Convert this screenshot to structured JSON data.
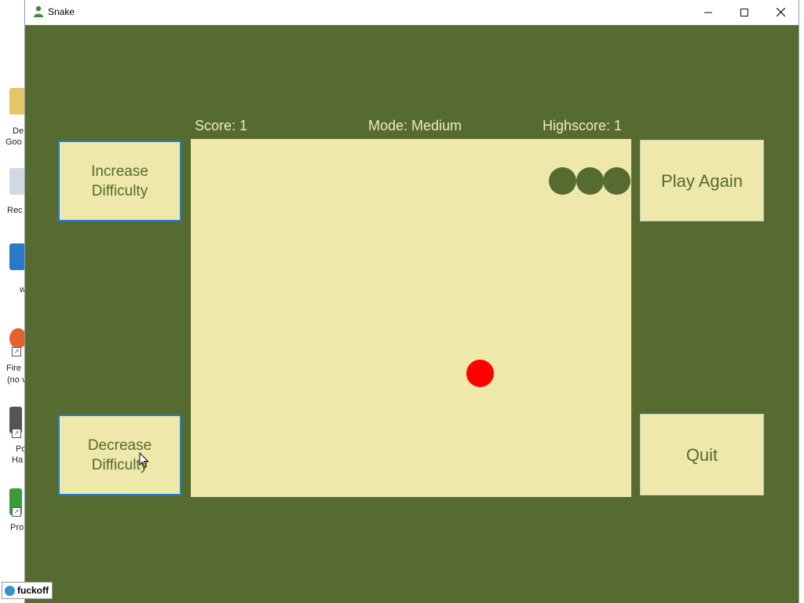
{
  "window": {
    "title": "Snake",
    "minimize_glyph": "—",
    "maximize_glyph": "☐",
    "close_glyph": "✕"
  },
  "desktop": {
    "labels": [
      "De",
      "Goo",
      "Rec",
      "w",
      "Fire",
      "(no v",
      "Po",
      "Ha",
      "Pro"
    ]
  },
  "status": {
    "score": "Score: 1",
    "mode": "Mode: Medium",
    "highscore": "Highscore: 1"
  },
  "buttons": {
    "increase": "Increase Difficulty",
    "decrease": "Decrease Difficulty",
    "play_again": "Play Again",
    "quit": "Quit"
  },
  "taskbar": {
    "chip_label": "fuckoff"
  },
  "colors": {
    "window_bg": "#556b2f",
    "board_bg": "#eee8aa",
    "snake": "#556b2f",
    "food": "#ff0000",
    "label_text": "#f0ebc0",
    "focus_border": "#1e7fd8"
  },
  "icons": {
    "app": "snake-person-icon",
    "cursor": "arrow-cursor-icon"
  }
}
